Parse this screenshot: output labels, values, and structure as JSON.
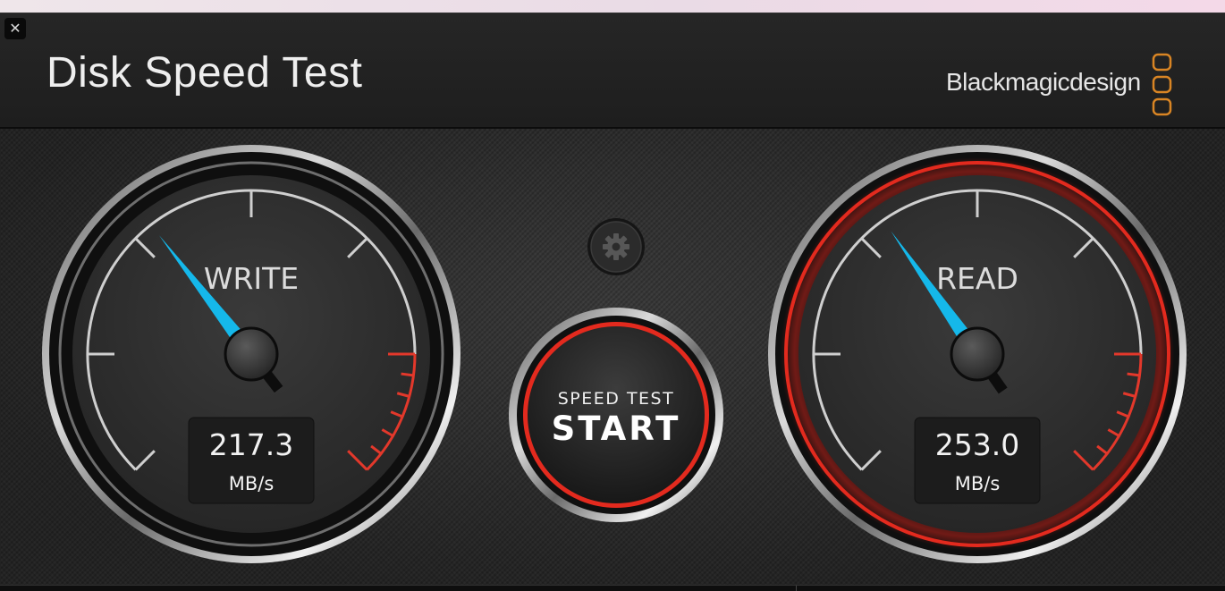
{
  "app": {
    "title": "Disk Speed Test",
    "brand": "Blackmagicdesign",
    "close_glyph": "✕",
    "icons": {
      "close": "close-icon",
      "settings": "gear-icon",
      "logo": "blackmagic-logo-icon"
    }
  },
  "write": {
    "label": "WRITE",
    "value": "217.3",
    "unit": "MB/s",
    "needle_fraction": 0.36,
    "active": false
  },
  "read": {
    "label": "READ",
    "value": "253.0",
    "unit": "MB/s",
    "needle_fraction": 0.37,
    "active": true
  },
  "start_button": {
    "line1": "SPEED TEST",
    "line2": "START"
  },
  "colors": {
    "needle": "#15b8ea",
    "redline": "#e3382b",
    "active_ring": "#e32a1e",
    "logo": "#d98524",
    "tick": "#cfcfcf"
  }
}
